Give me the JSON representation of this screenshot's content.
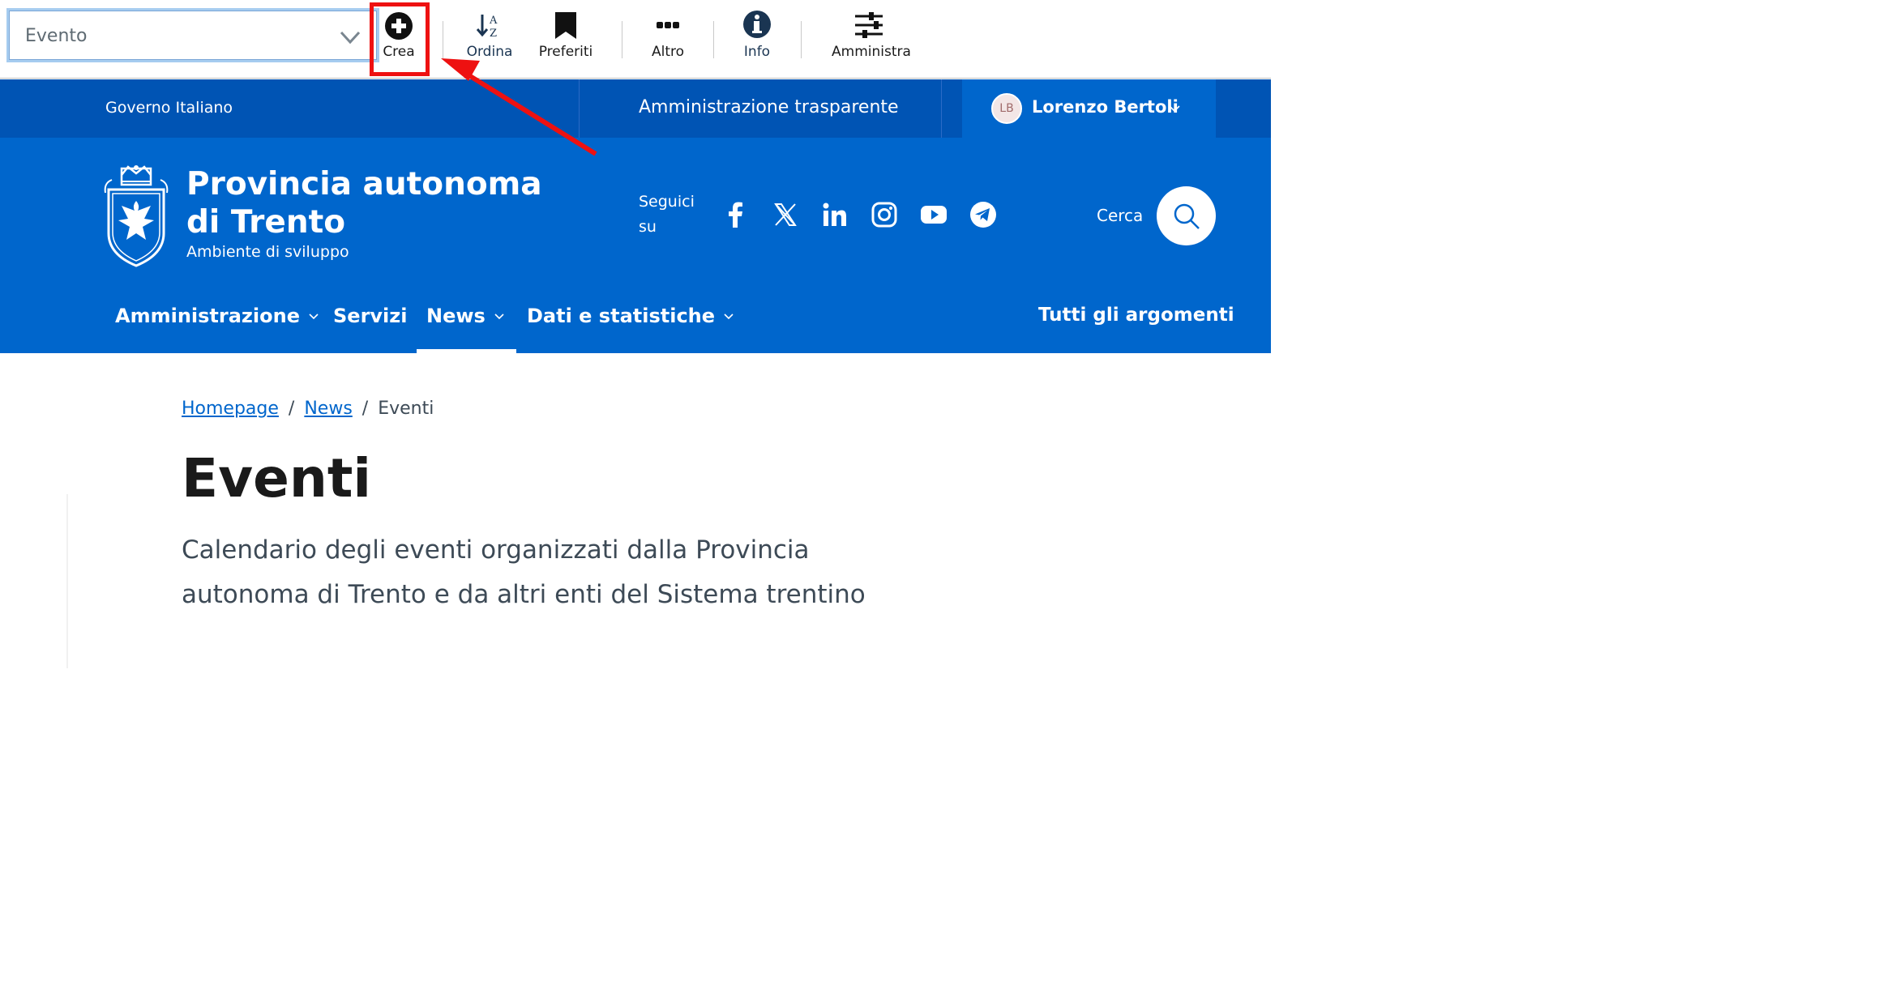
{
  "toolbar": {
    "select_value": "Evento",
    "crea_label": "Crea",
    "ordina_label": "Ordina",
    "preferiti_label": "Preferiti",
    "altro_label": "Altro",
    "info_label": "Info",
    "amministra_label": "Amministra"
  },
  "annotation": {
    "highlight_color": "#ee1111"
  },
  "slim_header": {
    "governo": "Governo Italiano",
    "trasparente": "Amministrazione trasparente",
    "user_initials": "LB",
    "user_name": "Lorenzo Bertoli"
  },
  "header": {
    "title": "Provincia autonoma di Trento",
    "subtitle": "Ambiente di sviluppo",
    "follow_label": "Seguici su",
    "social_icons": [
      "facebook-icon",
      "x-icon",
      "linkedin-icon",
      "instagram-icon",
      "youtube-icon",
      "telegram-icon"
    ],
    "search_label": "Cerca"
  },
  "nav": {
    "items": [
      {
        "label": "Amministrazione"
      },
      {
        "label": "Servizi"
      },
      {
        "label": "News"
      },
      {
        "label": "Dati e statistiche"
      }
    ],
    "all_topics": "Tutti gli argomenti"
  },
  "breadcrumb": {
    "home": "Homepage",
    "news": "News",
    "current": "Eventi",
    "separator": "/"
  },
  "page": {
    "title": "Eventi",
    "description": "Calendario degli eventi organizzati dalla Provincia autonoma di Trento e da altri enti del Sistema trentino"
  },
  "colors": {
    "brand_blue": "#0066cc",
    "slim_blue": "#0054b4",
    "text_dark": "#1a1a1a",
    "text_muted": "#3d4a56"
  }
}
